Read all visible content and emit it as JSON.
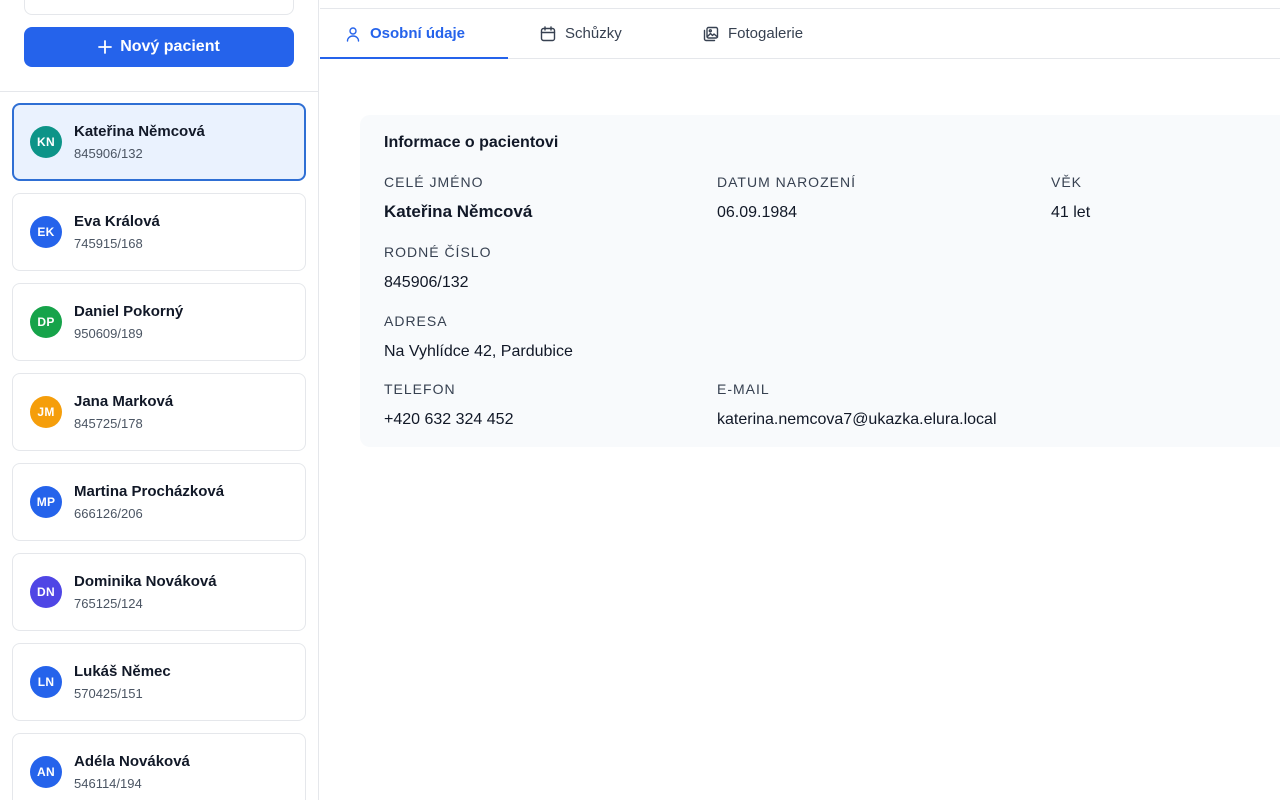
{
  "sidebar": {
    "new_patient_label": "Nový pacient",
    "patients": [
      {
        "initials": "KN",
        "name": "Kateřina Němcová",
        "id": "845906/132",
        "color": "#0d9488",
        "selected": true
      },
      {
        "initials": "EK",
        "name": "Eva Králová",
        "id": "745915/168",
        "color": "#2563eb"
      },
      {
        "initials": "DP",
        "name": "Daniel Pokorný",
        "id": "950609/189",
        "color": "#16a34a"
      },
      {
        "initials": "JM",
        "name": "Jana Marková",
        "id": "845725/178",
        "color": "#f59e0b"
      },
      {
        "initials": "MP",
        "name": "Martina Procházková",
        "id": "666126/206",
        "color": "#2563eb"
      },
      {
        "initials": "DN",
        "name": "Dominika Nováková",
        "id": "765125/124",
        "color": "#4f46e5"
      },
      {
        "initials": "LN",
        "name": "Lukáš Němec",
        "id": "570425/151",
        "color": "#2563eb"
      },
      {
        "initials": "AN",
        "name": "Adéla Nováková",
        "id": "546114/194",
        "color": "#2563eb"
      }
    ]
  },
  "tabs": [
    {
      "label": "Osobní údaje",
      "icon": "user-icon",
      "active": true
    },
    {
      "label": "Schůzky",
      "icon": "calendar-icon"
    },
    {
      "label": "Fotogalerie",
      "icon": "gallery-icon"
    }
  ],
  "card": {
    "title": "Informace o pacientovi",
    "full_name_label": "Celé jméno",
    "full_name": "Kateřina Němcová",
    "birth_label": "Datum narození",
    "birth": "06.09.1984",
    "age_label": "Věk",
    "age": "41 let",
    "rc_label": "Rodné číslo",
    "rc": "845906/132",
    "address_label": "Adresa",
    "address": "Na Vyhlídce 42, Pardubice",
    "phone_label": "Telefon",
    "phone": "+420 632 324 452",
    "email_label": "E-mail",
    "email": "katerina.nemcova7@ukazka.elura.local"
  },
  "colors": {
    "accent": "#2563eb",
    "selected_bg": "#eaf2fe",
    "card_bg": "#f8fafc"
  }
}
